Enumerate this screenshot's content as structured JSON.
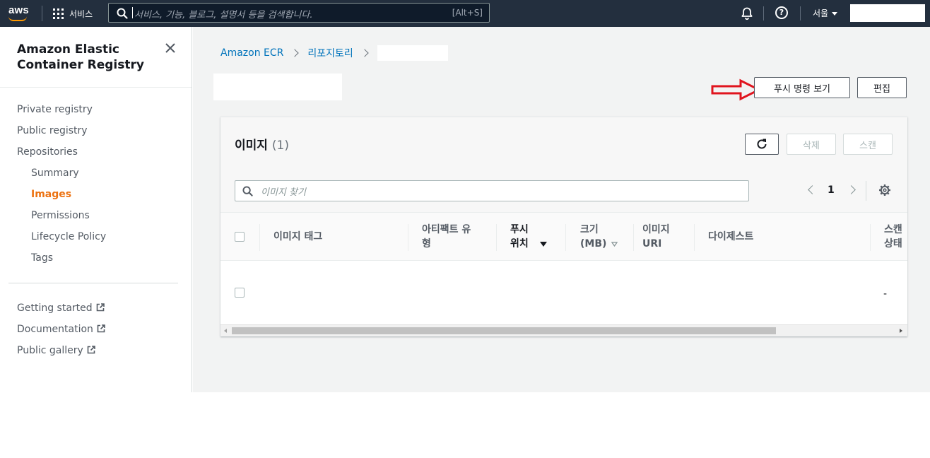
{
  "topnav": {
    "logo_text": "aws",
    "services_label": "서비스",
    "search_placeholder": "서비스, 기능, 블로그, 설명서 등을 검색합니다.",
    "search_shortcut": "[Alt+S]",
    "region_label": "서울"
  },
  "sidebar": {
    "title": "Amazon Elastic Container Registry",
    "items": [
      {
        "label": "Private registry"
      },
      {
        "label": "Public registry"
      },
      {
        "label": "Repositories"
      },
      {
        "label": "Summary"
      },
      {
        "label": "Images",
        "active": true
      },
      {
        "label": "Permissions"
      },
      {
        "label": "Lifecycle Policy"
      },
      {
        "label": "Tags"
      }
    ],
    "links": [
      {
        "label": "Getting started"
      },
      {
        "label": "Documentation"
      },
      {
        "label": "Public gallery"
      }
    ]
  },
  "breadcrumb": {
    "items": [
      "Amazon ECR",
      "리포지토리"
    ]
  },
  "actions": {
    "view_push_commands": "푸시 명령 보기",
    "edit": "편집"
  },
  "images_panel": {
    "title": "이미지",
    "count": "(1)",
    "delete_label": "삭제",
    "scan_label": "스캔",
    "search_placeholder": "이미지 찾기",
    "page_number": "1",
    "columns": {
      "tag": "이미지 태그",
      "artifact_type": [
        "아티팩트 유",
        "형"
      ],
      "pushed_at": [
        "푸시",
        "위치"
      ],
      "size": [
        "크기",
        "(MB)"
      ],
      "uri": [
        "이미지",
        "URI"
      ],
      "digest": "다이제스트",
      "scan_status": [
        "스캔",
        "상태"
      ]
    },
    "rows": [
      {
        "scan_status": "-"
      }
    ]
  },
  "colors": {
    "nav_bg": "#232f3e",
    "accent_orange": "#ec7211",
    "link_blue": "#0073bb",
    "annotation_arrow": "#e0141e"
  }
}
